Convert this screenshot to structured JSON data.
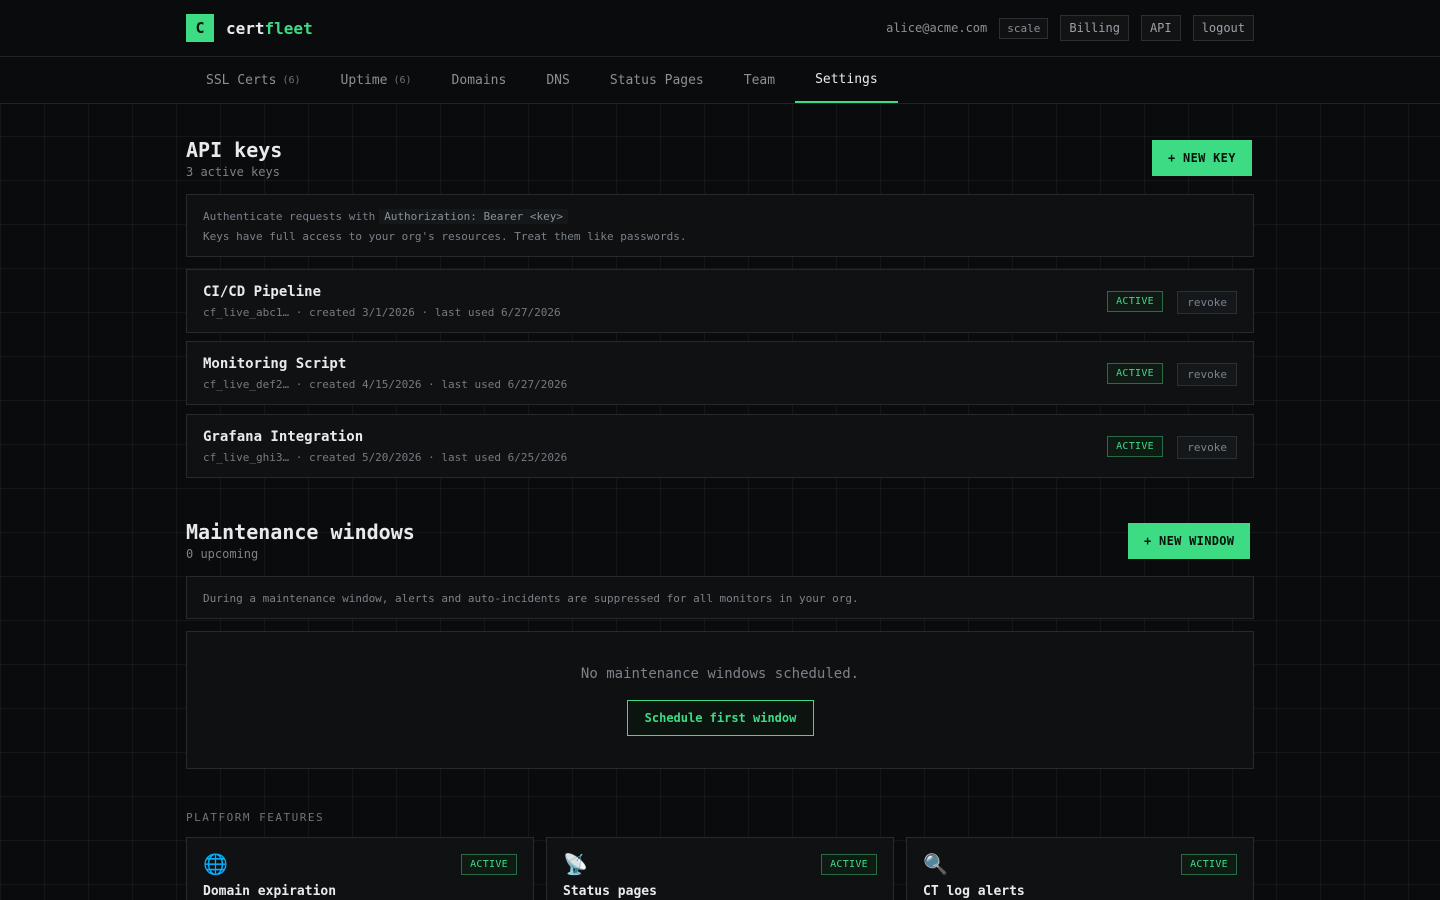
{
  "brand": {
    "logo_letter": "C",
    "name_part1": "cert",
    "name_part2": "fleet"
  },
  "header": {
    "user_email": "alice@acme.com",
    "plan": "scale",
    "billing_label": "Billing",
    "api_label": "API",
    "logout_label": "logout"
  },
  "tabs": [
    {
      "label": "SSL Certs",
      "count": "(6)"
    },
    {
      "label": "Uptime",
      "count": "(6)"
    },
    {
      "label": "Domains"
    },
    {
      "label": "DNS"
    },
    {
      "label": "Status Pages"
    },
    {
      "label": "Team"
    },
    {
      "label": "Settings",
      "active": true
    }
  ],
  "api_keys": {
    "title": "API keys",
    "subtitle": "3 active keys",
    "new_button": "+ NEW KEY",
    "info_line1_prefix": "Authenticate requests with",
    "info_line1_code": "Authorization: Bearer <key>",
    "info_line2": "Keys have full access to your org's resources. Treat them like passwords.",
    "keys": [
      {
        "name": "CI/CD Pipeline",
        "meta": "cf_live_abc1… · created 3/1/2026 · last used 6/27/2026",
        "status": "ACTIVE",
        "action": "revoke"
      },
      {
        "name": "Monitoring Script",
        "meta": "cf_live_def2… · created 4/15/2026 · last used 6/27/2026",
        "status": "ACTIVE",
        "action": "revoke"
      },
      {
        "name": "Grafana Integration",
        "meta": "cf_live_ghi3… · created 5/20/2026 · last used 6/25/2026",
        "status": "ACTIVE",
        "action": "revoke"
      }
    ]
  },
  "maintenance": {
    "title": "Maintenance windows",
    "subtitle": "0 upcoming",
    "new_button": "+ NEW WINDOW",
    "info": "During a maintenance window, alerts and auto-incidents are suppressed for all monitors in your org.",
    "empty_text": "No maintenance windows scheduled.",
    "schedule_button": "Schedule first window"
  },
  "features": {
    "label": "PLATFORM FEATURES",
    "items": [
      {
        "icon": "globe-icon",
        "glyph": "🌐",
        "name": "Domain expiration",
        "status": "ACTIVE"
      },
      {
        "icon": "satellite-dish-icon",
        "glyph": "📡",
        "name": "Status pages",
        "status": "ACTIVE"
      },
      {
        "icon": "magnifier-icon",
        "glyph": "🔍",
        "name": "CT log alerts",
        "status": "ACTIVE"
      }
    ]
  },
  "colors": {
    "accent": "#3ddc84",
    "background": "#0a0b0c"
  }
}
